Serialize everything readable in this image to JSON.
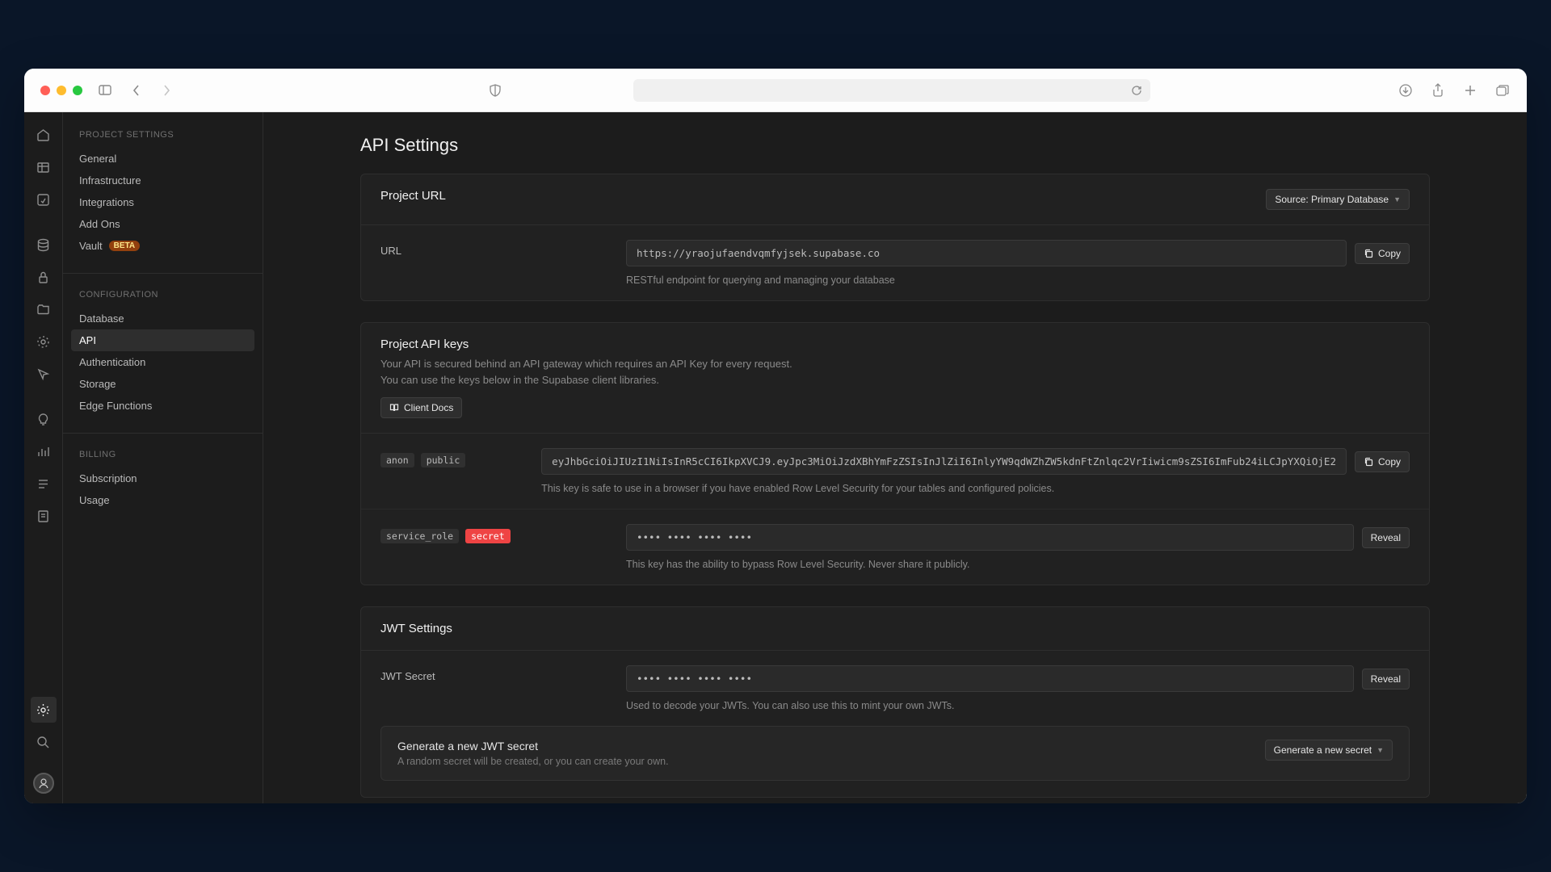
{
  "sidebar": {
    "groups": [
      {
        "heading": "PROJECT SETTINGS",
        "items": [
          {
            "label": "General"
          },
          {
            "label": "Infrastructure"
          },
          {
            "label": "Integrations"
          },
          {
            "label": "Add Ons"
          },
          {
            "label": "Vault",
            "badge": "BETA"
          }
        ]
      },
      {
        "heading": "CONFIGURATION",
        "items": [
          {
            "label": "Database"
          },
          {
            "label": "API",
            "active": true
          },
          {
            "label": "Authentication"
          },
          {
            "label": "Storage"
          },
          {
            "label": "Edge Functions"
          }
        ]
      },
      {
        "heading": "BILLING",
        "items": [
          {
            "label": "Subscription"
          },
          {
            "label": "Usage"
          }
        ]
      }
    ]
  },
  "page": {
    "title": "API Settings"
  },
  "project_url": {
    "title": "Project URL",
    "source_button": "Source: Primary Database",
    "row_label": "URL",
    "value": "https://yraojufaendvqmfyjsek.supabase.co",
    "copy_label": "Copy",
    "help": "RESTful endpoint for querying and managing your database"
  },
  "api_keys": {
    "title": "Project API keys",
    "desc_line1": "Your API is secured behind an API gateway which requires an API Key for every request.",
    "desc_line2": "You can use the keys below in the Supabase client libraries.",
    "client_docs": "Client Docs",
    "anon": {
      "tags": [
        "anon",
        "public"
      ],
      "value": "eyJhbGciOiJIUzI1NiIsInR5cCI6IkpXVCJ9.eyJpc3MiOiJzdXBhYmFzZSIsInJlZiI6InlyYW9qdWZhZW5kdnFtZnlqc2VrIiwicm9sZSI6ImFub24iLCJpYXQiOjE2",
      "copy_label": "Copy",
      "help": "This key is safe to use in a browser if you have enabled Row Level Security for your tables and configured policies."
    },
    "service": {
      "tags": [
        "service_role",
        "secret"
      ],
      "value": "•••• •••• •••• ••••",
      "reveal_label": "Reveal",
      "help": "This key has the ability to bypass Row Level Security. Never share it publicly."
    }
  },
  "jwt": {
    "title": "JWT Settings",
    "secret_label": "JWT Secret",
    "secret_value": "•••• •••• •••• ••••",
    "reveal_label": "Reveal",
    "secret_help": "Used to decode your JWTs. You can also use this to mint your own JWTs.",
    "generate_title": "Generate a new JWT secret",
    "generate_sub": "A random secret will be created, or you can create your own.",
    "generate_button": "Generate a new secret"
  }
}
